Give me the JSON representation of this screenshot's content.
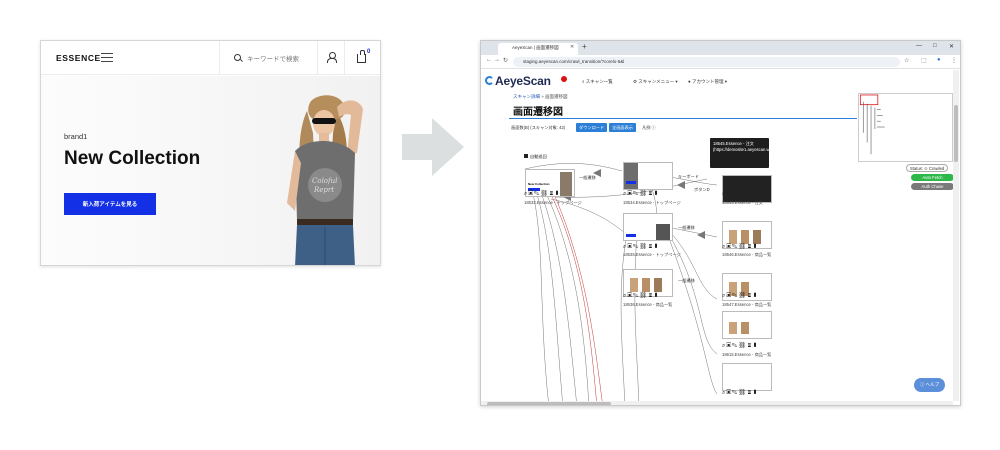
{
  "shop": {
    "logo": "ESSENCE",
    "search_placeholder": "キーワードで検索",
    "cart_count": "0",
    "hero_subtitle": "brand1",
    "hero_title": "New Collection",
    "hero_button": "新入荷アイテムを見る"
  },
  "browser": {
    "tab_title": "AeyeScan | 画面遷移図",
    "url": "staging.aeyescan.com/crawl_transition/?corelo-5&l",
    "app_name": "AeyeScan",
    "menu": [
      "スキャン一覧",
      "スキャンメニュー ▾",
      "アカウント管理 ▾"
    ],
    "breadcrumb_link": "スキャン詳細",
    "breadcrumb_current": "画面遷移図",
    "page_title": "画面遷移図",
    "page_info": "画面数(B) (スキャン対象: 42)",
    "download_button": "ダウンロード",
    "clear_button": "全画面表示",
    "legend_label": "凡例 ⓘ",
    "start_label": "自動巡回",
    "edges": [
      "一般遷移",
      "キーボード",
      "一般遷移",
      "一般遷移",
      "ボタンD",
      "一般遷移",
      "一般遷移"
    ],
    "nodes": [
      {
        "label": "18533.Essence - トップページ"
      },
      {
        "label": "18534.Essence - トップページ"
      },
      {
        "label": "18545.Essence - 注文"
      },
      {
        "label": "18535.Essence - トップページ"
      },
      {
        "label": "18546.Essence - 商品一覧"
      },
      {
        "label": "18536.Essence - 商品一覧"
      },
      {
        "label": "18547.Essence - 商品一覧"
      },
      {
        "label": "18615.Essence - 商品一覧"
      }
    ],
    "tooltip": "18545.Essence - 注文 (https://demosite1.aeyescan.work/1333/checkout)",
    "status_label": "Status: ⊙ Crawled",
    "auto_fetch": "Auto Fetch",
    "auto_chase": "Auth Chase",
    "help_button": "ⓘ ヘルプ",
    "window_controls": [
      "—",
      "□",
      "✕"
    ],
    "colors": {
      "accent": "#2b7fd6",
      "green": "#2fb84a",
      "gray": "#7a7a7a",
      "brand_blue": "#1330e6"
    }
  }
}
